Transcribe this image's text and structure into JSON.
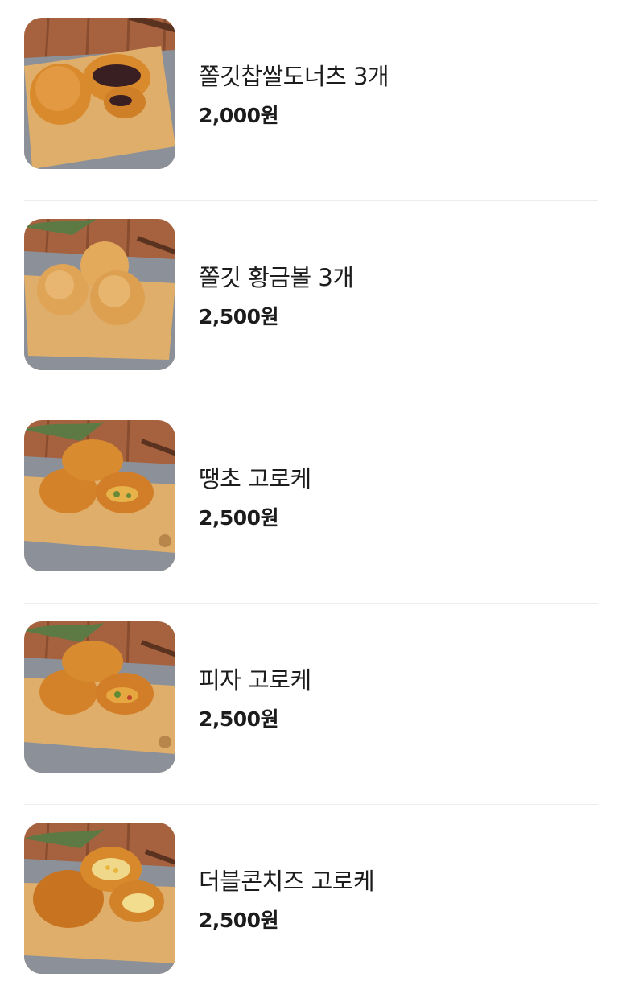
{
  "menu": {
    "items": [
      {
        "name": "쫄깃찹쌀도너츠 3개",
        "price": "2,000원",
        "image": "chapssal-donut-photo"
      },
      {
        "name": "쫄깃 황금볼 3개",
        "price": "2,500원",
        "image": "golden-ball-photo"
      },
      {
        "name": "땡초 고로케",
        "price": "2,500원",
        "image": "ttaengcho-croquette-photo"
      },
      {
        "name": "피자 고로케",
        "price": "2,500원",
        "image": "pizza-croquette-photo"
      },
      {
        "name": "더블콘치즈 고로케",
        "price": "2,500원",
        "image": "double-corn-cheese-croquette-photo"
      }
    ]
  },
  "colors": {
    "wood_table": "#9a5a3c",
    "cutting_board": "#e0b06e",
    "cloth": "#8c9199",
    "fried_golden": "#d9892e",
    "divider": "#ececec"
  }
}
